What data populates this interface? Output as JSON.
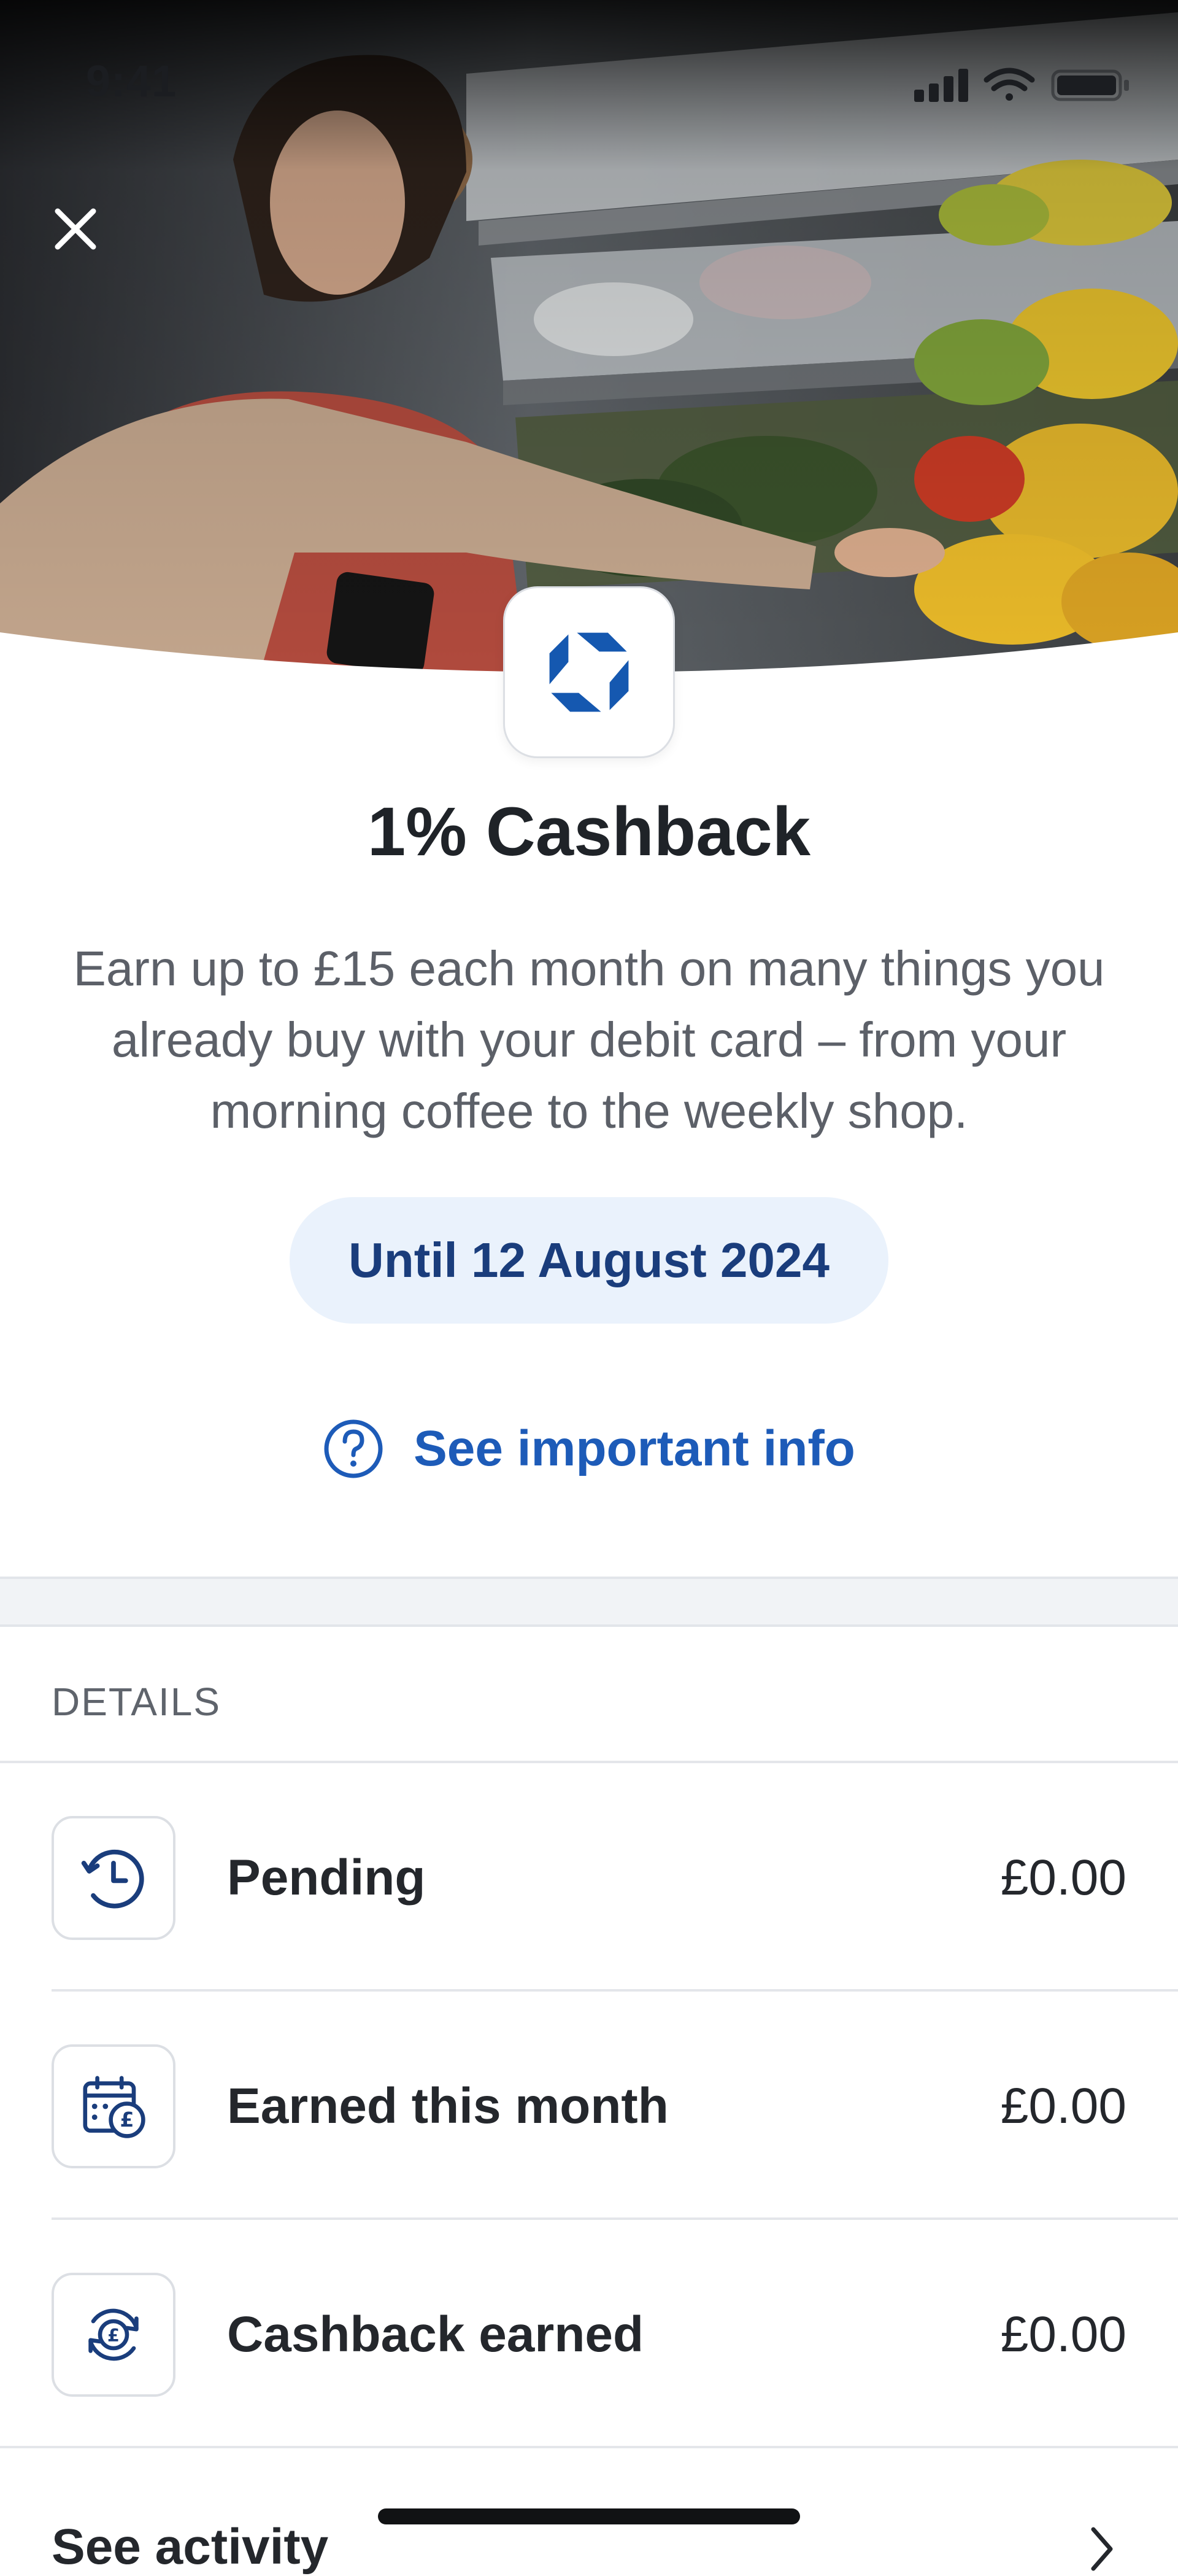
{
  "status_bar": {
    "time": "9:41"
  },
  "header": {
    "close_icon": "close-icon",
    "logo": "chase-octagon-logo"
  },
  "offer": {
    "title": "1% Cashback",
    "description": "Earn up to £15 each month on many things you already buy with your debit card – from your morning coffee to the weekly shop.",
    "valid_until": "Until 12 August 2024",
    "info_link": "See important info",
    "info_icon": "question-circle-icon"
  },
  "details": {
    "header": "DETAILS",
    "rows": [
      {
        "label": "Pending",
        "value": "£0.00",
        "icon": "clock-icon"
      },
      {
        "label": "Earned this month",
        "value": "£0.00",
        "icon": "calendar-pound-icon"
      },
      {
        "label": "Cashback earned",
        "value": "£0.00",
        "icon": "pound-cycle-icon"
      }
    ]
  },
  "activity": {
    "label": "See activity",
    "icon": "chevron-right-icon"
  },
  "colors": {
    "accent": "#1d5bb8",
    "brand": "#1558b0",
    "pill_bg": "#eaf2fc",
    "pill_text": "#1a3d7c"
  }
}
